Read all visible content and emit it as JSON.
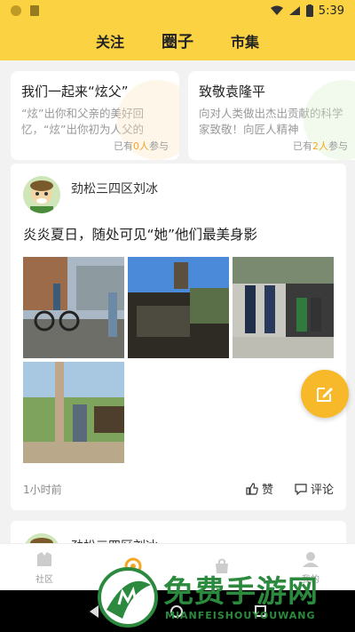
{
  "statusbar": {
    "time": "5:39"
  },
  "header": {
    "tabs": [
      {
        "label": "关注"
      },
      {
        "label": "圈子"
      },
      {
        "label": "市集"
      }
    ]
  },
  "topics": [
    {
      "title": "我们一起来“炫父”",
      "desc": "“炫”出你和父亲的美好回忆，“炫”出你初为人父的",
      "count_prefix": "已有",
      "count": "0人",
      "count_suffix": "参与",
      "accent": "#fde7c0"
    },
    {
      "title": "致敬袁隆平",
      "desc": "向对人类做出杰出贡献的科学家致敬！向匠人精神",
      "count_prefix": "已有",
      "count": "2人",
      "count_suffix": "参与",
      "accent": "#d7f0c9"
    }
  ],
  "post": {
    "username": "劲松三四区刘冰",
    "text": "炎炎夏日，随处可见“她”他们最美身影",
    "time": "1小时前",
    "like_label": "赞",
    "comment_label": "评论"
  },
  "post2": {
    "username": "劲松三四区刘冰"
  },
  "bottomnav": {
    "items": [
      {
        "label": "社区"
      },
      {
        "label": ""
      },
      {
        "label": ""
      },
      {
        "label": "我的"
      }
    ]
  },
  "watermark": {
    "title": "免费手游网",
    "sub": "MIANFEISHOUYOUWANG"
  },
  "colors": {
    "brand": "#fbd241",
    "accent": "#f5a623",
    "fab": "#f7b92a"
  }
}
